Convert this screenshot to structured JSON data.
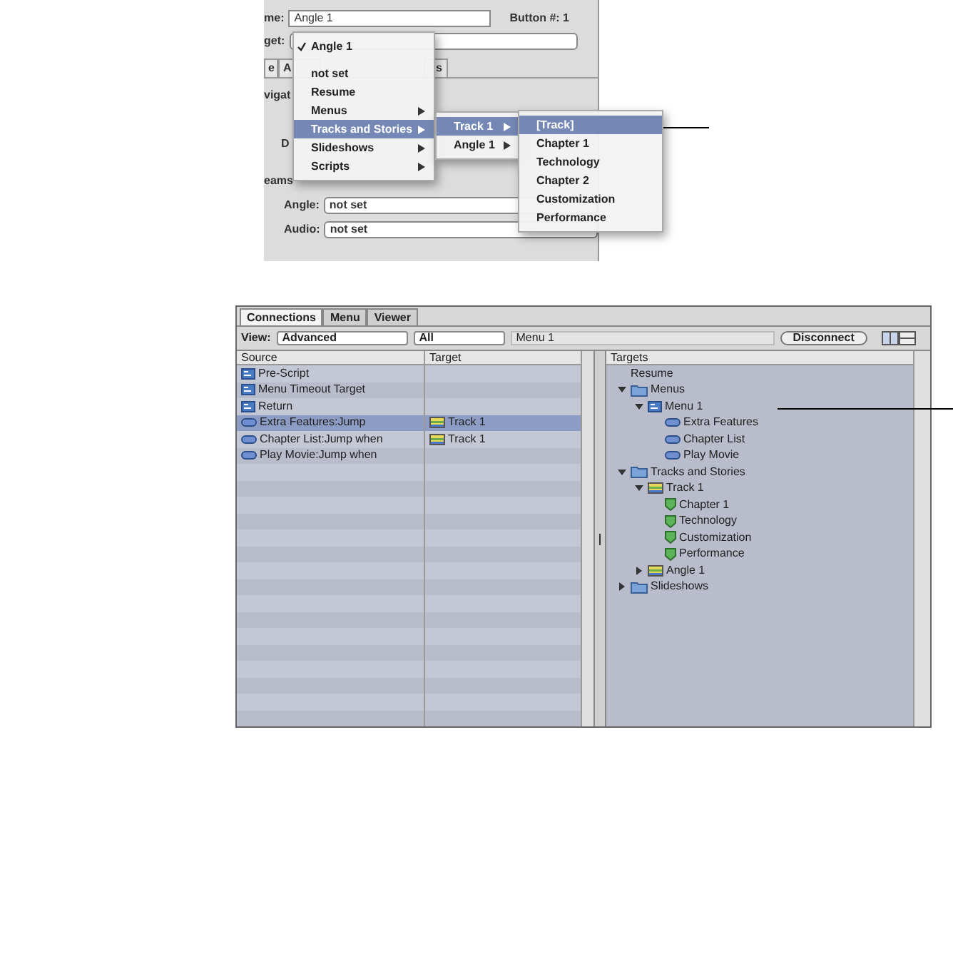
{
  "inspector": {
    "name_label": "me:",
    "name_value": "Angle 1",
    "button_number": "Button #: 1",
    "target_label": "get:",
    "tabs": [
      {
        "label": "e"
      },
      {
        "label": "A"
      },
      {
        "label": "s"
      }
    ],
    "section_1": "vigat",
    "row_label": "D",
    "section_2": "eams",
    "fields": [
      {
        "label": "Angle:",
        "value": "not set"
      },
      {
        "label": "Audio:",
        "value": "not set"
      }
    ]
  },
  "popup_menu": [
    {
      "kind": "checked",
      "label": "Angle 1",
      "selected": false
    },
    {
      "kind": "separator"
    },
    {
      "kind": "item",
      "label": "not set",
      "selected": false
    },
    {
      "kind": "item",
      "label": "Resume",
      "selected": false
    },
    {
      "kind": "submenu",
      "label": "Menus",
      "selected": false
    },
    {
      "kind": "submenu",
      "label": "Tracks and Stories",
      "selected": true
    },
    {
      "kind": "submenu",
      "label": "Slideshows",
      "selected": false
    },
    {
      "kind": "submenu",
      "label": "Scripts",
      "selected": false
    }
  ],
  "submenu": [
    {
      "kind": "submenu",
      "label": "Track 1",
      "selected": true
    },
    {
      "kind": "submenu",
      "label": "Angle 1",
      "selected": false
    }
  ],
  "subsubmenu": [
    {
      "label": "[Track]",
      "selected": true
    },
    {
      "label": "Chapter 1",
      "selected": false
    },
    {
      "label": "Technology",
      "selected": false
    },
    {
      "label": "Chapter 2",
      "selected": false
    },
    {
      "label": "Customization",
      "selected": false
    },
    {
      "label": "Performance",
      "selected": false
    }
  ],
  "connections": {
    "tabs": [
      {
        "label": "Connections",
        "selected": true
      },
      {
        "label": "Menu",
        "selected": false
      },
      {
        "label": "Viewer",
        "selected": false
      }
    ],
    "view_label": "View:",
    "view_popup": "Advanced",
    "filter_popup": "All",
    "current_item": "Menu 1",
    "disconnect_button": "Disconnect",
    "columns": [
      "Source",
      "Target"
    ],
    "rows": [
      {
        "source": "Pre-Script",
        "kind": "menu",
        "selected": false
      },
      {
        "source": "Menu Timeout Target",
        "kind": "menu",
        "selected": false
      },
      {
        "source": "Return",
        "kind": "menu",
        "selected": false
      },
      {
        "source": "Extra Features:Jump",
        "kind": "button",
        "target": "Track 1",
        "selected": true
      },
      {
        "source": "Chapter List:Jump when",
        "kind": "button",
        "target": "Track 1",
        "selected": false
      },
      {
        "source": "Play Movie:Jump when",
        "kind": "button",
        "selected": false
      }
    ],
    "targets_heading": "Targets",
    "tree": [
      {
        "label": "Resume",
        "kind": "plain"
      },
      {
        "label": "Menus",
        "kind": "folder",
        "expanded": true,
        "children": [
          {
            "label": "Menu 1",
            "kind": "menu",
            "expanded": true,
            "children": [
              {
                "label": "Extra Features",
                "kind": "button"
              },
              {
                "label": "Chapter List",
                "kind": "button"
              },
              {
                "label": "Play Movie",
                "kind": "button"
              }
            ]
          }
        ]
      },
      {
        "label": "Tracks and Stories",
        "kind": "folder",
        "expanded": true,
        "children": [
          {
            "label": "Track 1",
            "kind": "track",
            "expanded": true,
            "children": [
              {
                "label": "Chapter 1",
                "kind": "marker"
              },
              {
                "label": "Technology",
                "kind": "marker"
              },
              {
                "label": "Customization",
                "kind": "marker"
              },
              {
                "label": "Performance",
                "kind": "marker"
              }
            ]
          },
          {
            "label": "Angle 1",
            "kind": "track",
            "expanded": false
          }
        ]
      },
      {
        "label": "Slideshows",
        "kind": "folder",
        "expanded": false
      }
    ]
  }
}
